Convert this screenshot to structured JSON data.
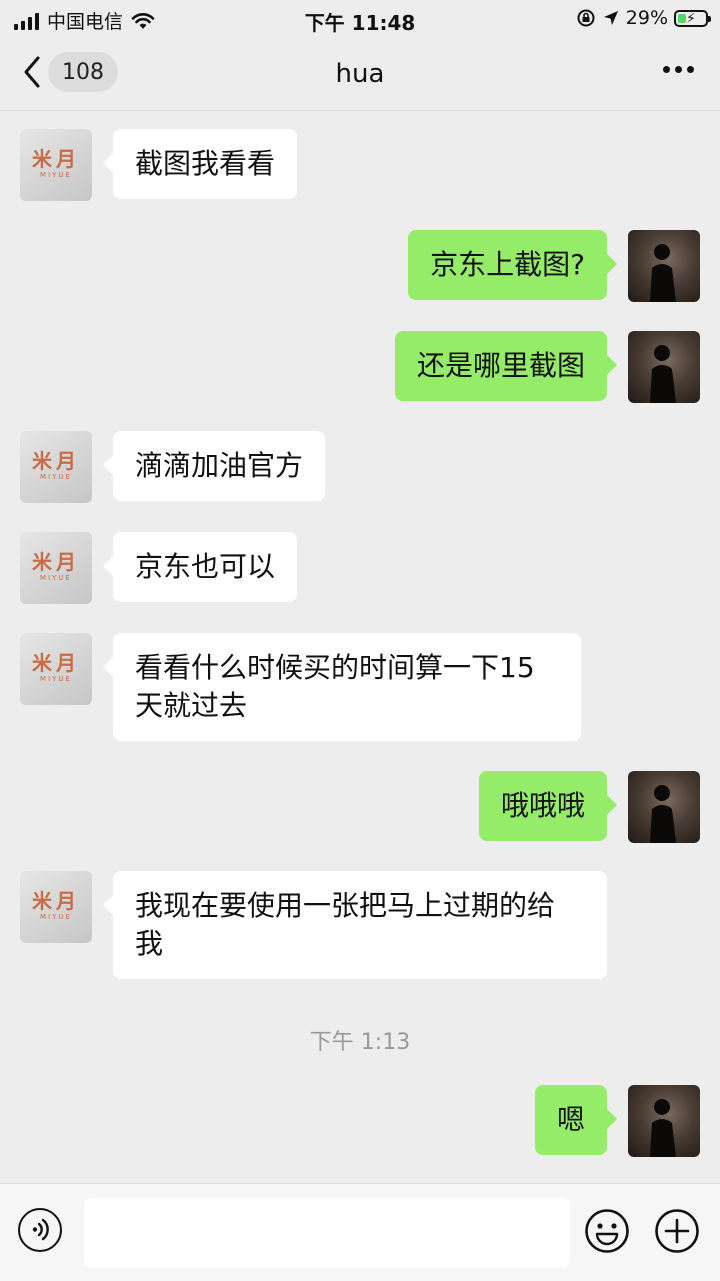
{
  "status_bar": {
    "carrier": "中国电信",
    "time": "下午 11:48",
    "battery": "29%",
    "icons": [
      "signal-icon",
      "wifi-icon",
      "rotation-lock-icon",
      "location-icon",
      "battery-charging-icon"
    ]
  },
  "nav": {
    "back_count": "108",
    "title": "hua",
    "icons": [
      "back-chevron-icon",
      "more-dots-icon"
    ]
  },
  "messages": [
    {
      "side": "left",
      "text": "截图我看看"
    },
    {
      "side": "right",
      "text": "京东上截图?"
    },
    {
      "side": "right",
      "text": "还是哪里截图"
    },
    {
      "side": "left",
      "text": "滴滴加油官方"
    },
    {
      "side": "left",
      "text": "京东也可以"
    },
    {
      "side": "left",
      "text": "看看什么时候买的时间算一下15\n天就过去"
    },
    {
      "side": "right",
      "text": "哦哦哦"
    },
    {
      "side": "left",
      "text": "我现在要使用一张把马上过期的给\n我"
    },
    {
      "side": "right",
      "text": "嗯"
    }
  ],
  "timestamp": "下午 1:13",
  "avatar_left": {
    "logo": "米月",
    "logo_sub": "MIYUE",
    "logo_color": "#c96c45"
  },
  "input_bar": {
    "placeholder": "",
    "icons": [
      "voice-icon",
      "emoji-icon",
      "plus-icon"
    ]
  },
  "colors": {
    "bubble_self": "#95ec69",
    "bubble_other": "#ffffff",
    "background": "#ededed"
  }
}
